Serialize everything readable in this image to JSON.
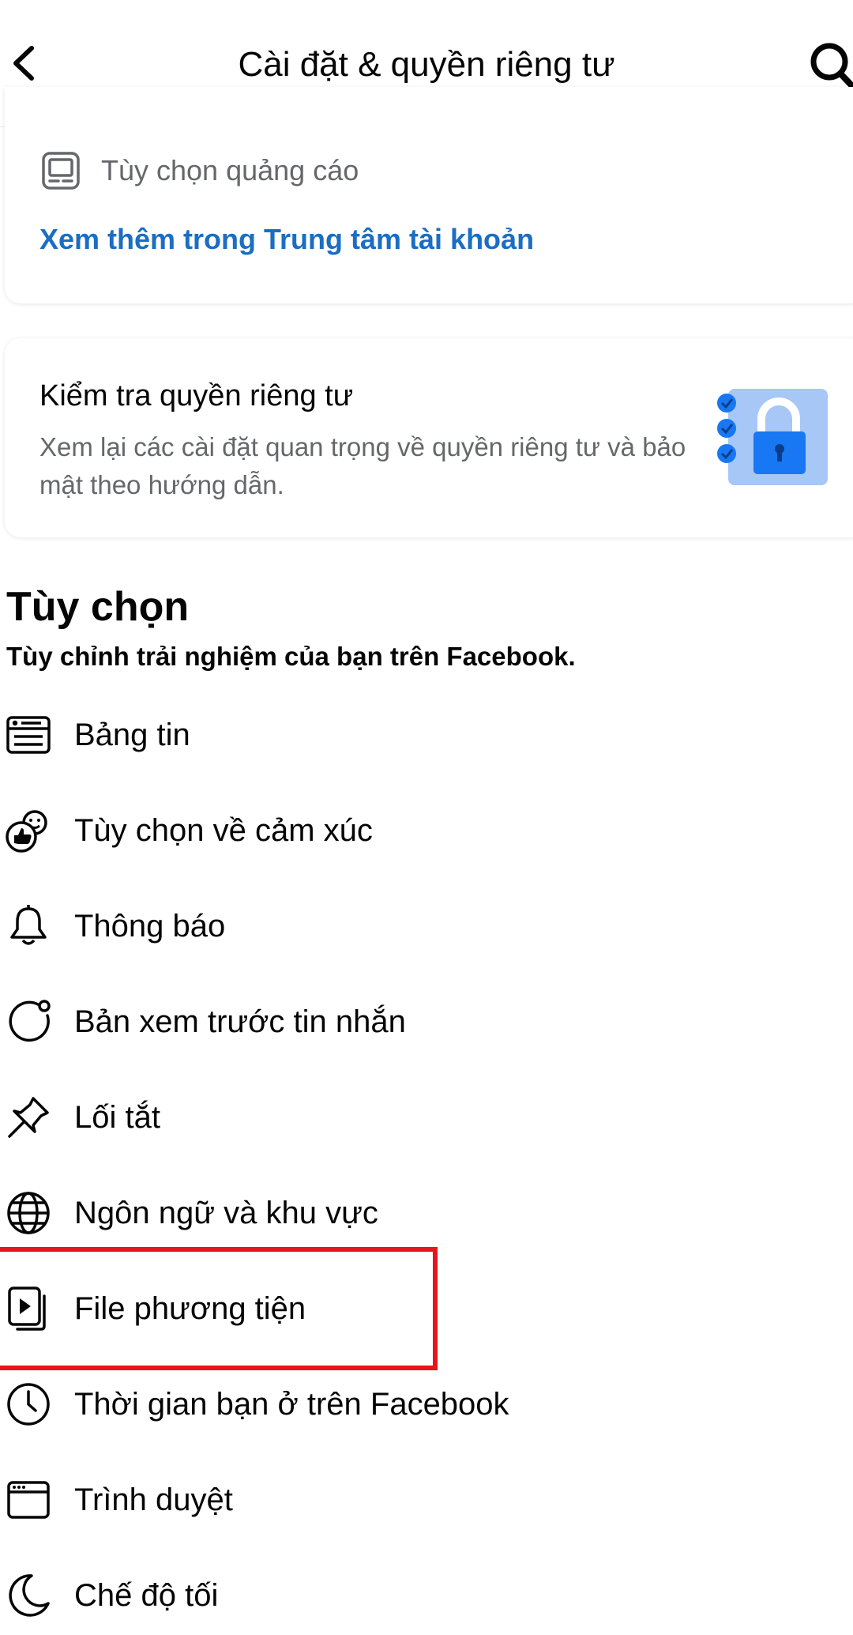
{
  "header": {
    "title": "Cài đặt & quyền riêng tư"
  },
  "top_card": {
    "ads_label": "Tùy chọn quảng cáo",
    "more_link": "Xem thêm trong Trung tâm tài khoản"
  },
  "privacy_card": {
    "title": "Kiểm tra quyền riêng tư",
    "description": "Xem lại các cài đặt quan trọng về quyền riêng tư và bảo mật theo hướng dẫn."
  },
  "preferences": {
    "title": "Tùy chọn",
    "subtitle": "Tùy chỉnh trải nghiệm của bạn trên Facebook.",
    "items": [
      {
        "label": "Bảng tin",
        "icon": "news-feed-icon"
      },
      {
        "label": "Tùy chọn về cảm xúc",
        "icon": "reactions-icon"
      },
      {
        "label": "Thông báo",
        "icon": "bell-icon"
      },
      {
        "label": "Bản xem trước tin nhắn",
        "icon": "message-preview-icon"
      },
      {
        "label": "Lối tắt",
        "icon": "pin-icon"
      },
      {
        "label": "Ngôn ngữ và khu vực",
        "icon": "globe-icon"
      },
      {
        "label": "File phương tiện",
        "icon": "media-icon"
      },
      {
        "label": "Thời gian bạn ở trên Facebook",
        "icon": "clock-icon"
      },
      {
        "label": "Trình duyệt",
        "icon": "browser-icon"
      },
      {
        "label": "Chế độ tối",
        "icon": "moon-icon"
      }
    ]
  },
  "colors": {
    "link": "#1b6ec2",
    "highlight": "#e8151c",
    "secondary_text": "#65676b",
    "illustration_blue": "#1877f2"
  }
}
